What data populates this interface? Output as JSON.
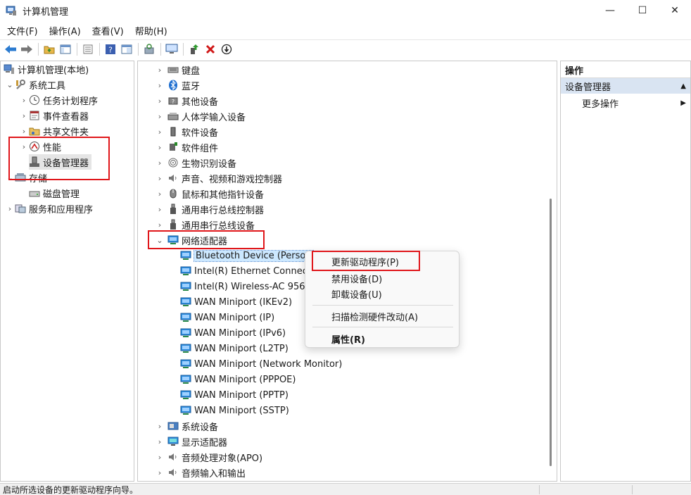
{
  "window": {
    "title": "计算机管理",
    "minimize": "—",
    "maximize": "☐",
    "close": "✕"
  },
  "menu": [
    "文件(F)",
    "操作(A)",
    "查看(V)",
    "帮助(H)"
  ],
  "left_tree": [
    {
      "label": "计算机管理(本地)",
      "icon": "computer-management-icon",
      "indent": 0,
      "chevron": ""
    },
    {
      "label": "系统工具",
      "icon": "system-tools-icon",
      "indent": 1,
      "chevron": "v"
    },
    {
      "label": "任务计划程序",
      "icon": "clock-icon",
      "indent": 2,
      "chevron": ">"
    },
    {
      "label": "事件查看器",
      "icon": "event-viewer-icon",
      "indent": 2,
      "chevron": ">"
    },
    {
      "label": "共享文件夹",
      "icon": "shared-folder-icon",
      "indent": 2,
      "chevron": ">"
    },
    {
      "label": "性能",
      "icon": "performance-icon",
      "indent": 2,
      "chevron": ">"
    },
    {
      "label": "设备管理器",
      "icon": "device-manager-icon",
      "indent": 2,
      "chevron": "",
      "selected": true
    },
    {
      "label": "存储",
      "icon": "storage-icon",
      "indent": 1,
      "chevron": "v"
    },
    {
      "label": "磁盘管理",
      "icon": "disk-icon",
      "indent": 2,
      "chevron": ""
    },
    {
      "label": "服务和应用程序",
      "icon": "services-icon",
      "indent": 1,
      "chevron": ">"
    }
  ],
  "device_tree": [
    {
      "label": "键盘",
      "icon": "keyboard-icon",
      "level": 0,
      "chevron": ">"
    },
    {
      "label": "蓝牙",
      "icon": "bluetooth-icon",
      "level": 0,
      "chevron": ">"
    },
    {
      "label": "其他设备",
      "icon": "other-devices-icon",
      "level": 0,
      "chevron": ">"
    },
    {
      "label": "人体学输入设备",
      "icon": "hid-icon",
      "level": 0,
      "chevron": ">"
    },
    {
      "label": "软件设备",
      "icon": "software-device-icon",
      "level": 0,
      "chevron": ">"
    },
    {
      "label": "软件组件",
      "icon": "software-component-icon",
      "level": 0,
      "chevron": ">"
    },
    {
      "label": "生物识别设备",
      "icon": "fingerprint-icon",
      "level": 0,
      "chevron": ">"
    },
    {
      "label": "声音、视频和游戏控制器",
      "icon": "speaker-icon",
      "level": 0,
      "chevron": ">"
    },
    {
      "label": "鼠标和其他指针设备",
      "icon": "mouse-icon",
      "level": 0,
      "chevron": ">"
    },
    {
      "label": "通用串行总线控制器",
      "icon": "usb-icon",
      "level": 0,
      "chevron": ">"
    },
    {
      "label": "通用串行总线设备",
      "icon": "usb-icon",
      "level": 0,
      "chevron": ">"
    },
    {
      "label": "网络适配器",
      "icon": "network-adapter-icon",
      "level": 0,
      "chevron": "v"
    },
    {
      "label": "Bluetooth Device (Person",
      "icon": "network-adapter-icon",
      "level": 1,
      "chevron": "",
      "selected": true
    },
    {
      "label": "Intel(R) Ethernet Connect",
      "icon": "network-adapter-icon",
      "level": 1,
      "chevron": ""
    },
    {
      "label": "Intel(R) Wireless-AC 9560",
      "icon": "network-adapter-icon",
      "level": 1,
      "chevron": ""
    },
    {
      "label": "WAN Miniport (IKEv2)",
      "icon": "network-adapter-icon",
      "level": 1,
      "chevron": ""
    },
    {
      "label": "WAN Miniport (IP)",
      "icon": "network-adapter-icon",
      "level": 1,
      "chevron": ""
    },
    {
      "label": "WAN Miniport (IPv6)",
      "icon": "network-adapter-icon",
      "level": 1,
      "chevron": ""
    },
    {
      "label": "WAN Miniport (L2TP)",
      "icon": "network-adapter-icon",
      "level": 1,
      "chevron": ""
    },
    {
      "label": "WAN Miniport (Network Monitor)",
      "icon": "network-adapter-icon",
      "level": 1,
      "chevron": ""
    },
    {
      "label": "WAN Miniport (PPPOE)",
      "icon": "network-adapter-icon",
      "level": 1,
      "chevron": ""
    },
    {
      "label": "WAN Miniport (PPTP)",
      "icon": "network-adapter-icon",
      "level": 1,
      "chevron": ""
    },
    {
      "label": "WAN Miniport (SSTP)",
      "icon": "network-adapter-icon",
      "level": 1,
      "chevron": ""
    },
    {
      "label": "系统设备",
      "icon": "system-device-icon",
      "level": 0,
      "chevron": ">"
    },
    {
      "label": "显示适配器",
      "icon": "display-adapter-icon",
      "level": 0,
      "chevron": ">"
    },
    {
      "label": "音频处理对象(APO)",
      "icon": "speaker-icon",
      "level": 0,
      "chevron": ">"
    },
    {
      "label": "音频输入和输出",
      "icon": "speaker-icon",
      "level": 0,
      "chevron": ">"
    }
  ],
  "actions_pane": {
    "header": "操作",
    "section": "设备管理器",
    "more": "更多操作"
  },
  "context_menu": {
    "update_driver": "更新驱动程序(P)",
    "disable_device": "禁用设备(D)",
    "uninstall_device": "卸载设备(U)",
    "scan_hardware": "扫描检测硬件改动(A)",
    "properties": "属性(R)"
  },
  "status": {
    "text": "启动所选设备的更新驱动程序向导。"
  },
  "colors": {
    "highlight_red": "#e0161a",
    "selection_blue": "#cce8ff",
    "section_blue": "#d9e4f2"
  }
}
